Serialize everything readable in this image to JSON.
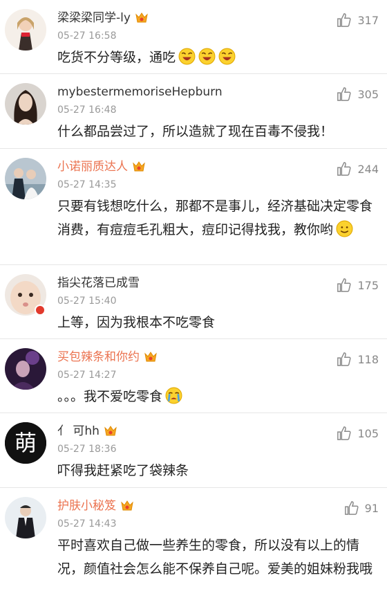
{
  "comments": [
    {
      "name": "梁梁梁同学-ly",
      "time": "05-27 16:58",
      "text": "吃货不分等级，通吃",
      "likes": "317",
      "icon": "avatar-girl-cartoon",
      "name_color": "#333333"
    },
    {
      "name": "mybestermemoriseHepburn",
      "time": "05-27 16:48",
      "text": "什么都品尝过了，所以造就了现在百毒不侵我！",
      "likes": "305",
      "icon": "avatar-woman-portrait"
    },
    {
      "name": "小诺丽质达人",
      "time": "05-27 14:35",
      "text": "只要有钱想吃什么，那都不是事儿，经济基础决定零食消费，有痘痘毛孔粗大，痘印记得找我，教你哟",
      "likes": "244",
      "icon": "avatar-couple"
    },
    {
      "name": "指尖花落已成雪",
      "time": "05-27 15:40",
      "text": "上等，因为我根本不吃零食",
      "likes": "175",
      "icon": "avatar-baby"
    },
    {
      "name": "买包辣条和你约",
      "time": "05-27 14:27",
      "text": "。。。我不爱吃零食",
      "likes": "118",
      "icon": "avatar-dark-purple"
    },
    {
      "name": "亻 可hh",
      "time": "05-27 18:36",
      "text": "吓得我赶紧吃了袋辣条",
      "likes": "105",
      "icon": "avatar-meng-char",
      "avatar_char": "萌"
    },
    {
      "name": "护肤小秘笈",
      "time": "05-27 14:43",
      "text": "平时喜欢自己做一些养生的零食，所以没有以上的情况，颜值社会怎么能不保养自己呢。爱美的姐妹粉我哦",
      "likes": "91",
      "icon": "avatar-man-suit"
    }
  ],
  "colors": {
    "orange_name": "#eb7350",
    "meta": "#999999",
    "divider": "#e6e6e6"
  }
}
